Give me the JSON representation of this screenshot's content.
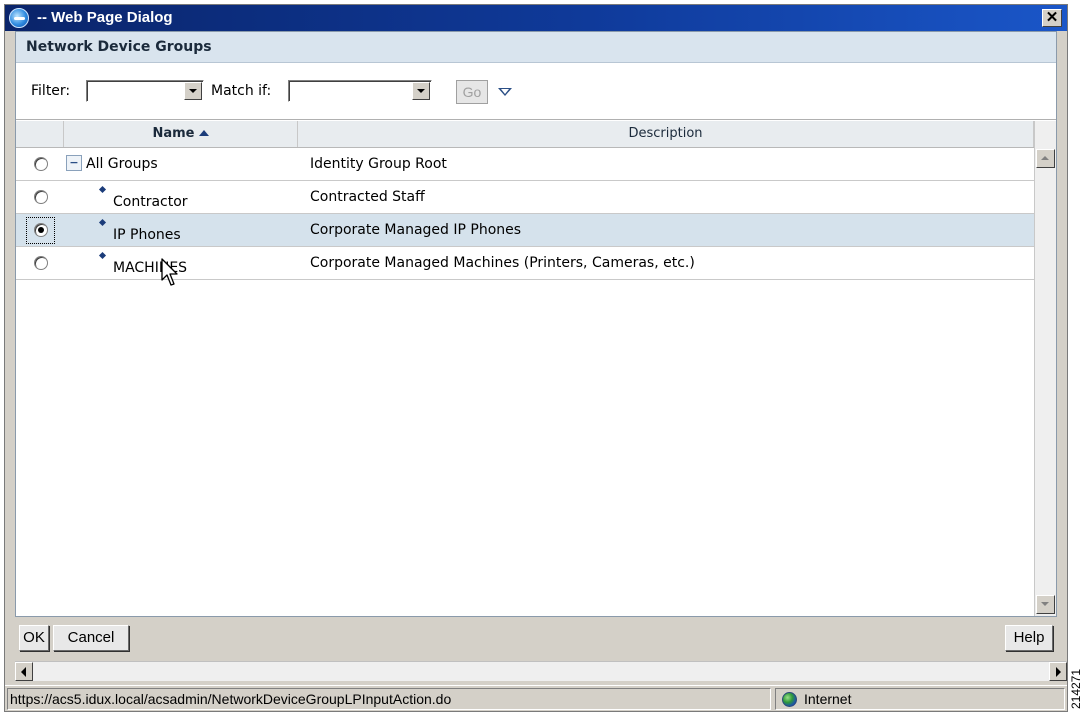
{
  "window": {
    "title": "-- Web Page Dialog",
    "close_label": "✕"
  },
  "panel": {
    "title": "Network Device Groups"
  },
  "filter": {
    "filter_label": "Filter:",
    "filter_value": "",
    "match_label": "Match if:",
    "match_value": "",
    "go_label": "Go"
  },
  "table": {
    "columns": {
      "name": "Name",
      "description": "Description"
    },
    "rows": [
      {
        "name": "All Groups",
        "description": "Identity Group Root"
      },
      {
        "name": "Contractor",
        "description": "Contracted Staff"
      },
      {
        "name": "IP Phones",
        "description": "Corporate Managed IP Phones"
      },
      {
        "name": "MACHINES",
        "description": "Corporate Managed Machines (Printers, Cameras, etc.)"
      }
    ],
    "selected_row": "IP Phones"
  },
  "footer": {
    "ok_label": "OK",
    "cancel_label": "Cancel",
    "help_label": "Help"
  },
  "status": {
    "url": "https://acs5.idux.local/acsadmin/NetworkDeviceGroupLPInputAction.do",
    "zone": "Internet"
  },
  "figure_id": "214271",
  "icons": {
    "window": "ie-page-icon",
    "zone": "globe-icon",
    "expander": "tree-collapse-icon",
    "cursor": "mouse-pointer-icon"
  }
}
